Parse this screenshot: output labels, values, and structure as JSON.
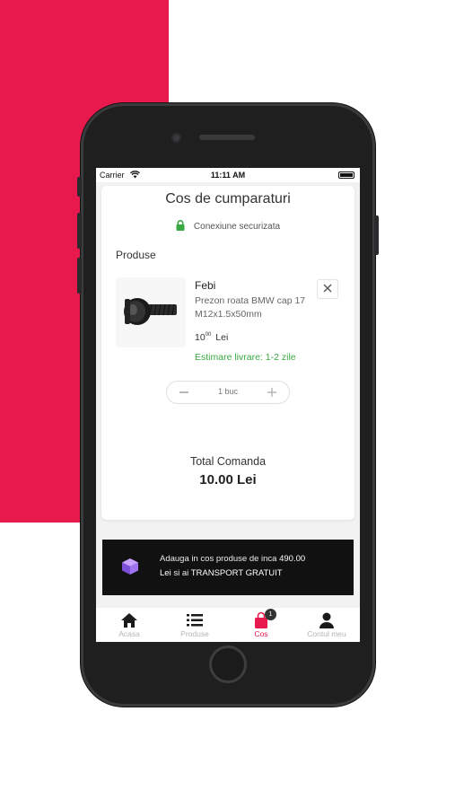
{
  "colors": {
    "brand": "#e8194d",
    "success": "#3aa843",
    "banner_bg": "#111111"
  },
  "status_bar": {
    "carrier": "Carrier",
    "time": "11:11 AM"
  },
  "cart": {
    "title": "Cos de cumparaturi",
    "secure_text": "Conexiune securizata",
    "section_label": "Produse",
    "item": {
      "brand": "Febi",
      "name": "Prezon roata BMW cap 17 M12x1.5x50mm",
      "price_int": "10",
      "price_dec": "00",
      "currency": "Lei",
      "delivery": "Estimare livrare: 1-2 zile",
      "quantity": "1 buc"
    },
    "total_label": "Total Comanda",
    "total_value": "10.00 Lei"
  },
  "banner": {
    "text_1": "Adauga in cos produse de inca",
    "amount": "490.00",
    "text_2": "Lei",
    "text_3": "si ai",
    "highlight": "TRANSPORT GRATUIT"
  },
  "tabs": [
    {
      "label": "Acasa",
      "icon": "home-icon"
    },
    {
      "label": "Produse",
      "icon": "list-icon"
    },
    {
      "label": "Cos",
      "icon": "bag-icon",
      "badge": "1",
      "active": true
    },
    {
      "label": "Contul meu",
      "icon": "user-icon"
    }
  ]
}
